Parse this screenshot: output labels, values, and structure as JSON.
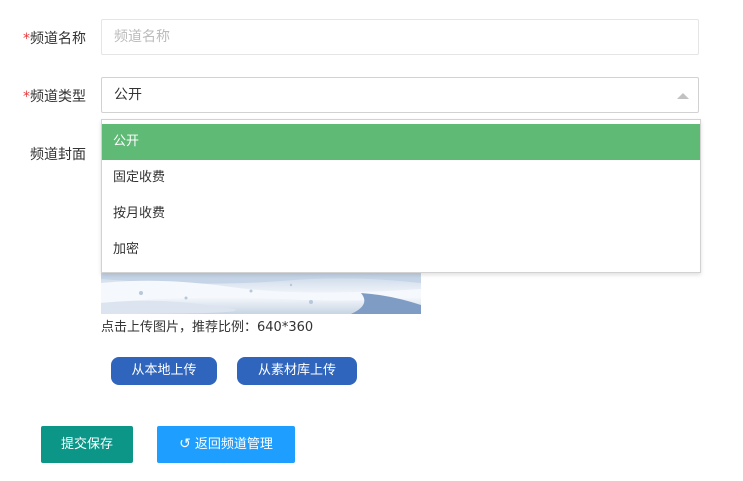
{
  "form": {
    "name": {
      "required_mark": "*",
      "label": "频道名称",
      "placeholder": "频道名称",
      "value": ""
    },
    "type": {
      "required_mark": "*",
      "label": "频道类型",
      "selected": "公开",
      "options": [
        "公开",
        "固定收费",
        "按月收费",
        "加密"
      ]
    },
    "cover": {
      "label": "频道封面",
      "hint": "点击上传图片，推荐比例：640*360"
    }
  },
  "upload_buttons": {
    "local": "从本地上传",
    "library": "从素材库上传"
  },
  "actions": {
    "submit": "提交保存",
    "back_icon": "undo-icon",
    "back": "返回频道管理"
  },
  "colors": {
    "selected_option": "#5fba76",
    "upload_button": "#2f65bc",
    "submit_button": "#0c9688",
    "back_button": "#1e9fff",
    "required_mark": "#e4393c"
  }
}
